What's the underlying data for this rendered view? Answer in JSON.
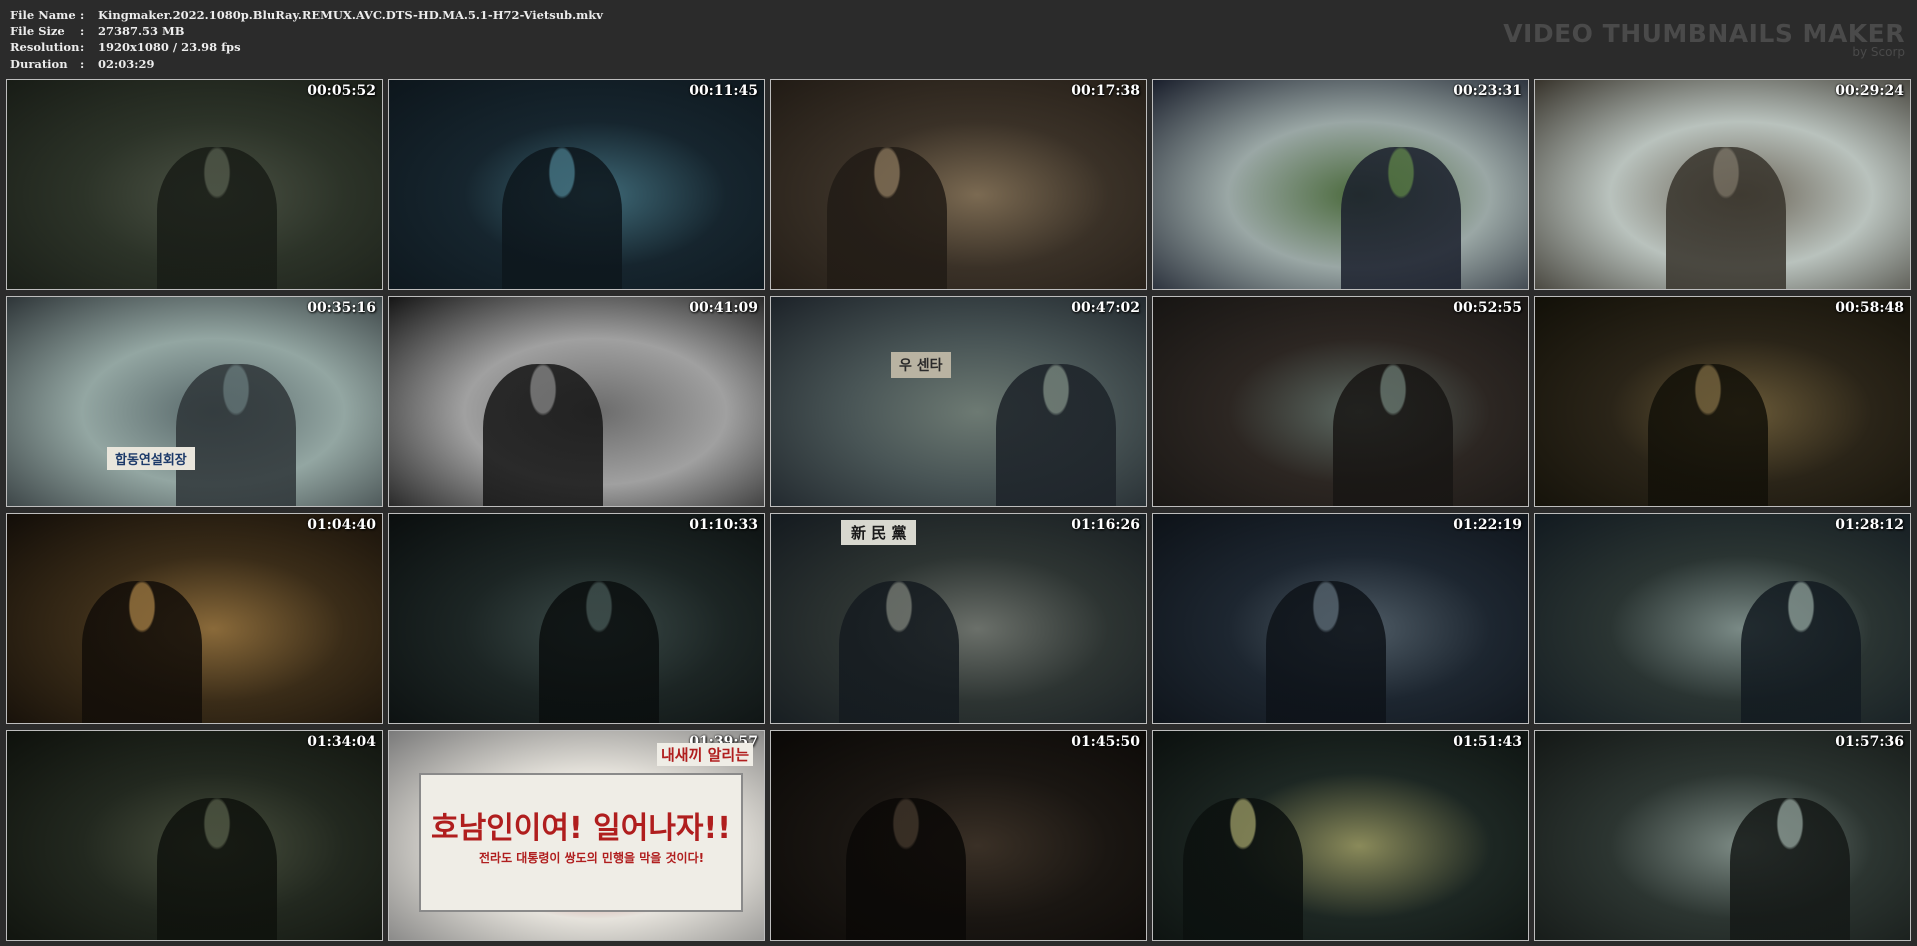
{
  "file_info": {
    "rows": [
      {
        "label": "File Name",
        "value": "Kingmaker.2022.1080p.BluRay.REMUX.AVC.DTS-HD.MA.5.1-H72-Vietsub.mkv"
      },
      {
        "label": "File Size",
        "value": "27387.53 MB"
      },
      {
        "label": "Resolution",
        "value": "1920x1080 / 23.98 fps"
      },
      {
        "label": "Duration",
        "value": "02:03:29"
      }
    ],
    "separator": ":"
  },
  "brand": {
    "title": "VIDEO THUMBNAILS MAKER",
    "subtitle": "by Scorp"
  },
  "thumbnails": [
    {
      "timestamp": "00:05:52",
      "palette": [
        "#2c3328",
        "#4b5244",
        "#181c16"
      ]
    },
    {
      "timestamp": "00:11:45",
      "palette": [
        "#16252e",
        "#3f6a78",
        "#0d161c"
      ]
    },
    {
      "timestamp": "00:17:38",
      "palette": [
        "#3a3127",
        "#7b6a52",
        "#211b15"
      ]
    },
    {
      "timestamp": "00:23:31",
      "palette": [
        "#9aa7a5",
        "#4b6a3c",
        "#1a1f2c"
      ]
    },
    {
      "timestamp": "00:29:24",
      "palette": [
        "#b9c2bd",
        "#6b6457",
        "#37332b"
      ]
    },
    {
      "timestamp": "00:35:16",
      "palette": [
        "#93a6a2",
        "#58686a",
        "#2e3538"
      ]
    },
    {
      "timestamp": "00:41:09",
      "palette": [
        "#a0a0a0",
        "#6b6b6b",
        "#151515"
      ]
    },
    {
      "timestamp": "00:47:02",
      "palette": [
        "#485455",
        "#6d7a73",
        "#1c2228"
      ]
    },
    {
      "timestamp": "00:52:55",
      "palette": [
        "#2c2622",
        "#5d6a63",
        "#171513"
      ]
    },
    {
      "timestamp": "00:58:48",
      "palette": [
        "#2a2418",
        "#6a5a38",
        "#121008"
      ]
    },
    {
      "timestamp": "01:04:40",
      "palette": [
        "#3a2c18",
        "#8a6a3a",
        "#120d08"
      ]
    },
    {
      "timestamp": "01:10:33",
      "palette": [
        "#1c2524",
        "#3b4a48",
        "#0a0e0e"
      ]
    },
    {
      "timestamp": "01:16:26",
      "palette": [
        "#2d3432",
        "#6b706a",
        "#141a1f"
      ]
    },
    {
      "timestamp": "01:22:19",
      "palette": [
        "#1d2630",
        "#4f5c66",
        "#0d1218"
      ]
    },
    {
      "timestamp": "01:28:12",
      "palette": [
        "#2a3432",
        "#7a8a86",
        "#121a20"
      ]
    },
    {
      "timestamp": "01:34:04",
      "palette": [
        "#22281f",
        "#49503e",
        "#0e110c"
      ]
    },
    {
      "timestamp": "01:39:57",
      "palette": [
        "#e6e3dc",
        "#b52a2a",
        "#7a7a7a"
      ]
    },
    {
      "timestamp": "01:45:50",
      "palette": [
        "#1a1612",
        "#3a3026",
        "#0a0806"
      ]
    },
    {
      "timestamp": "01:51:43",
      "palette": [
        "#1d2723",
        "#8a8a5a",
        "#0b100e"
      ]
    },
    {
      "timestamp": "01:57:36",
      "palette": [
        "#2c3531",
        "#7c8a84",
        "#141816"
      ]
    }
  ],
  "signs": {
    "boat_banner": "합동연설회장",
    "shop_sign": "우    센타",
    "party_sign": "新  民  黨",
    "banner_main": "호남인이여! 일어나자!!",
    "banner_sub": "전라도 대통령이 쌍도의 민행을 막을 것이다!",
    "banner_top": "내새끼 알리는"
  }
}
